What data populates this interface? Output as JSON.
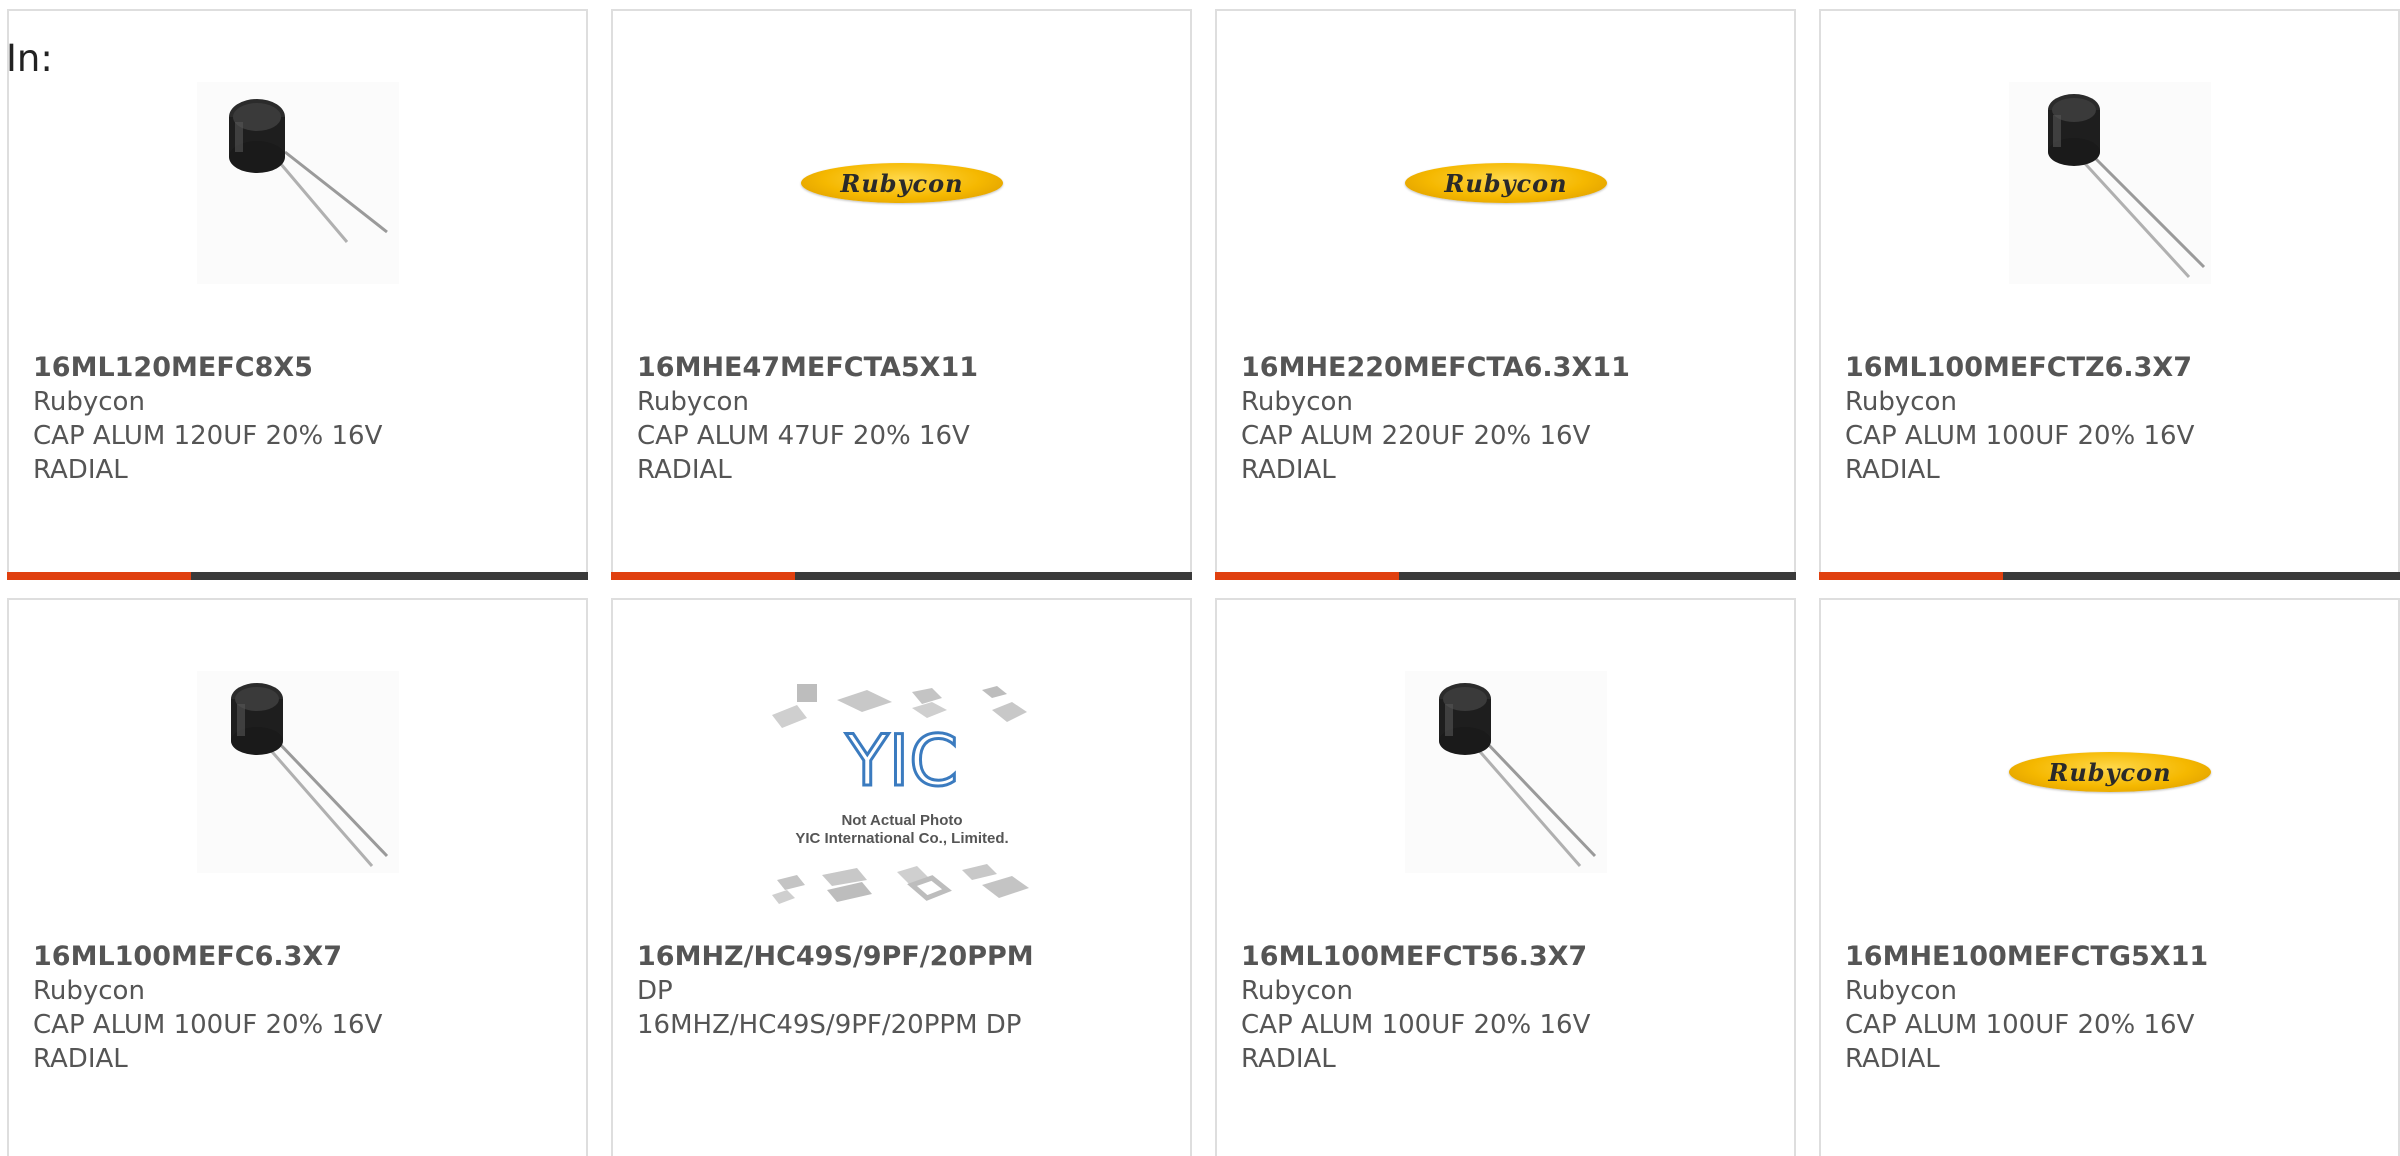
{
  "filter_label": "In:",
  "colors": {
    "accent": "#e0400f",
    "bar": "#3a3a3a",
    "text": "#555555",
    "border": "#dedede",
    "logo_yellow": "#f5b800"
  },
  "products": [
    {
      "part_number": "16ML120MEFC8X5",
      "manufacturer": "Rubycon",
      "description_1": "CAP ALUM 120UF 20% 16V",
      "description_2": "RADIAL",
      "image": "capacitor-photo-icon"
    },
    {
      "part_number": "16MHE47MEFCTA5X11",
      "manufacturer": "Rubycon",
      "description_1": "CAP ALUM 47UF 20% 16V",
      "description_2": "RADIAL",
      "image": "rubycon-logo",
      "logo_text": "Rubycon"
    },
    {
      "part_number": "16MHE220MEFCTA6.3X11",
      "manufacturer": "Rubycon",
      "description_1": "CAP ALUM 220UF 20% 16V",
      "description_2": "RADIAL",
      "image": "rubycon-logo",
      "logo_text": "Rubycon"
    },
    {
      "part_number": "16ML100MEFCTZ6.3X7",
      "manufacturer": "Rubycon",
      "description_1": "CAP ALUM 100UF 20% 16V",
      "description_2": "RADIAL",
      "image": "capacitor-photo-icon"
    },
    {
      "part_number": "16ML100MEFC6.3X7",
      "manufacturer": "Rubycon",
      "description_1": "CAP ALUM 100UF 20% 16V",
      "description_2": "RADIAL",
      "image": "capacitor-photo-icon"
    },
    {
      "part_number": "16MHZ/HC49S/9PF/20PPM",
      "manufacturer": "DP",
      "description_1": "16MHZ/HC49S/9PF/20PPM DP",
      "description_2": "",
      "image": "yic-placeholder",
      "placeholder_line_1": "Not Actual Photo",
      "placeholder_line_2": "YIC International Co., Limited."
    },
    {
      "part_number": "16ML100MEFCT56.3X7",
      "manufacturer": "Rubycon",
      "description_1": "CAP ALUM 100UF 20% 16V",
      "description_2": "RADIAL",
      "image": "capacitor-photo-icon"
    },
    {
      "part_number": "16MHE100MEFCTG5X11",
      "manufacturer": "Rubycon",
      "description_1": "CAP ALUM 100UF 20% 16V",
      "description_2": "RADIAL",
      "image": "rubycon-logo",
      "logo_text": "Rubycon"
    }
  ]
}
